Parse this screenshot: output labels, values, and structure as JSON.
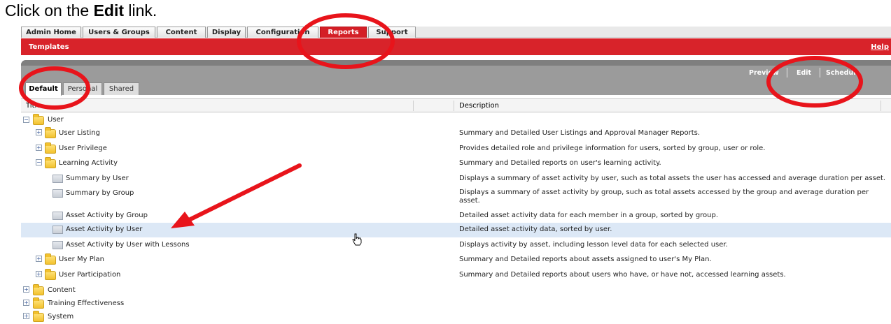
{
  "instruction": {
    "prefix": "Click on the ",
    "bold": "Edit",
    "suffix": " link."
  },
  "top_tabs": [
    "Admin Home",
    "Users & Groups",
    "Content",
    "Display",
    "Configuration",
    "Reports",
    "Support"
  ],
  "active_top_tab": "Reports",
  "section": {
    "title": "Templates",
    "help": "Help"
  },
  "actions": [
    "Preview",
    "Edit",
    "Schedule"
  ],
  "sub_tabs": [
    "Default",
    "Personal",
    "Shared"
  ],
  "active_sub_tab": "Default",
  "columns": {
    "title": "Title",
    "description": "Description"
  },
  "rows": [
    {
      "title": "User",
      "description": "",
      "type": "folder",
      "expanded": true
    },
    {
      "title": "User Listing",
      "description": "Summary and Detailed User Listings and Approval Manager Reports.",
      "type": "folder",
      "expanded": false
    },
    {
      "title": "User Privilege",
      "description": "Provides detailed role and privilege information for users, sorted by group, user or role.",
      "type": "folder",
      "expanded": false
    },
    {
      "title": "Learning Activity",
      "description": "Summary and Detailed reports on user's learning activity.",
      "type": "folder",
      "expanded": true
    },
    {
      "title": "Summary by User",
      "description": "Displays a summary of asset activity by user, such as total assets the user has accessed and average duration per asset.",
      "type": "report"
    },
    {
      "title": "Summary by Group",
      "description": "Displays a summary of asset activity by group, such as total assets accessed by the group and average duration per asset.",
      "type": "report"
    },
    {
      "title": "Asset Activity by Group",
      "description": "Detailed asset activity data for each member in a group, sorted by group.",
      "type": "report"
    },
    {
      "title": "Asset Activity by User",
      "description": "Detailed asset activity data, sorted by user.",
      "type": "report",
      "selected": true
    },
    {
      "title": "Asset Activity by User with Lessons",
      "description": "Displays activity by asset, including lesson level data for each selected user.",
      "type": "report"
    },
    {
      "title": "User My Plan",
      "description": "Summary and Detailed reports about assets assigned to user's My Plan.",
      "type": "folder",
      "expanded": false
    },
    {
      "title": "User Participation",
      "description": "Summary and Detailed reports about users who have, or have not, accessed learning assets.",
      "type": "folder",
      "expanded": false
    },
    {
      "title": "Content",
      "description": "",
      "type": "folder",
      "expanded": false
    },
    {
      "title": "Training Effectiveness",
      "description": "",
      "type": "folder",
      "expanded": false
    },
    {
      "title": "System",
      "description": "",
      "type": "folder",
      "expanded": false
    }
  ],
  "colors": {
    "brand_red": "#d8232a",
    "selected_row": "#dce8f6",
    "annotation_red": "#e8141b",
    "panel_gray": "#9b9b9b"
  },
  "icons": {
    "expand": "plus-box-icon",
    "collapse": "minus-box-icon",
    "folder": "folder-icon",
    "report": "report-icon",
    "cursor": "hand-pointer-icon"
  }
}
